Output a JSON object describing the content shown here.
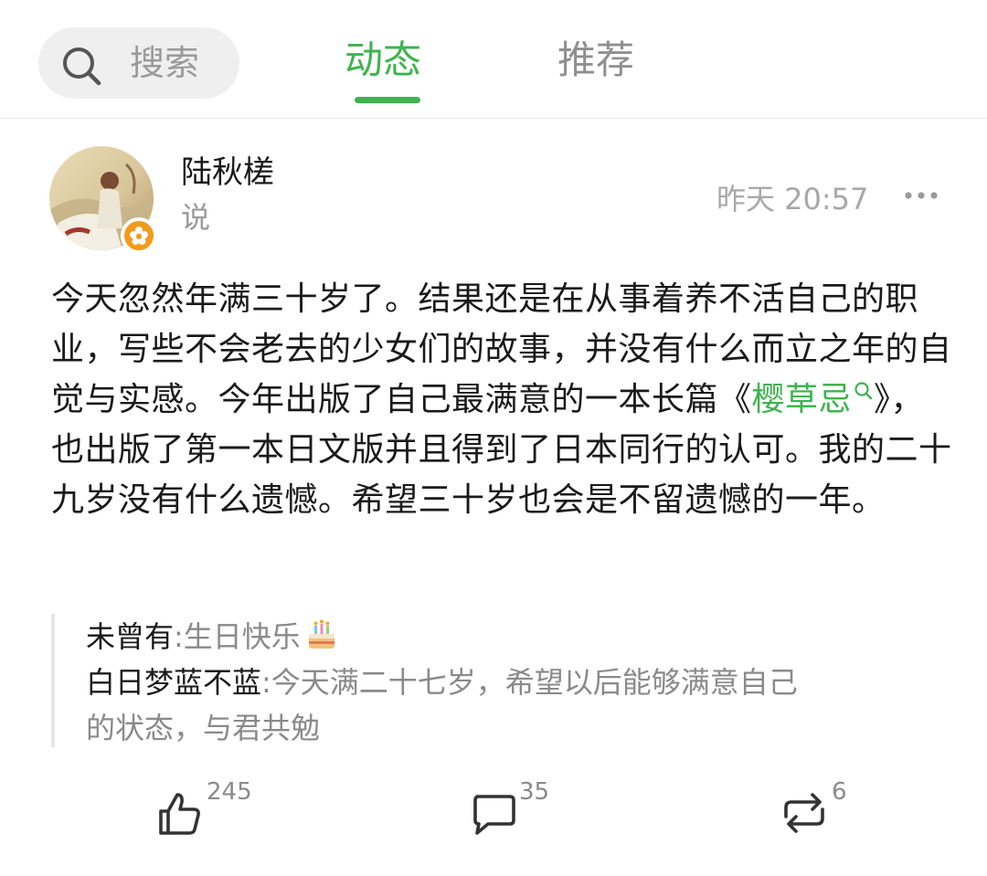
{
  "header": {
    "search_label": "搜索",
    "tabs": [
      {
        "label": "动态",
        "active": true
      },
      {
        "label": "推荐",
        "active": false
      }
    ],
    "accent_color": "#3fb34f"
  },
  "post": {
    "author": "陆秋槎",
    "action": "说",
    "time": "昨天 20:57",
    "body_before": "今天忽然年满三十岁了。结果还是在从事着养不活自己的职业，写些不会老去的少女们的故事，并没有什么而立之年的自觉与实感。今年出版了自己最满意的一本长篇《",
    "topic": "樱草忌",
    "body_after": "》，也出版了第一本日文版并且得到了日本同行的认可。我的二十九岁没有什么遗憾。希望三十岁也会是不留遗憾的一年。",
    "comments": [
      {
        "user": "未曾有",
        "text": "生日快乐"
      },
      {
        "user": "白日梦蓝不蓝",
        "text": "今天满二十七岁，希望以后能够满意自己",
        "text_cont": "的状态，与君共勉"
      }
    ],
    "stats": {
      "likes": "245",
      "comments": "35",
      "reposts": "6"
    }
  },
  "icons": {
    "search": "search-icon",
    "more": "more-dots-icon",
    "like": "thumbs-up-icon",
    "comment": "comment-bubble-icon",
    "repost": "repost-icon",
    "badge": "flower-badge-icon",
    "cake": "birthday-cake-emoji"
  }
}
